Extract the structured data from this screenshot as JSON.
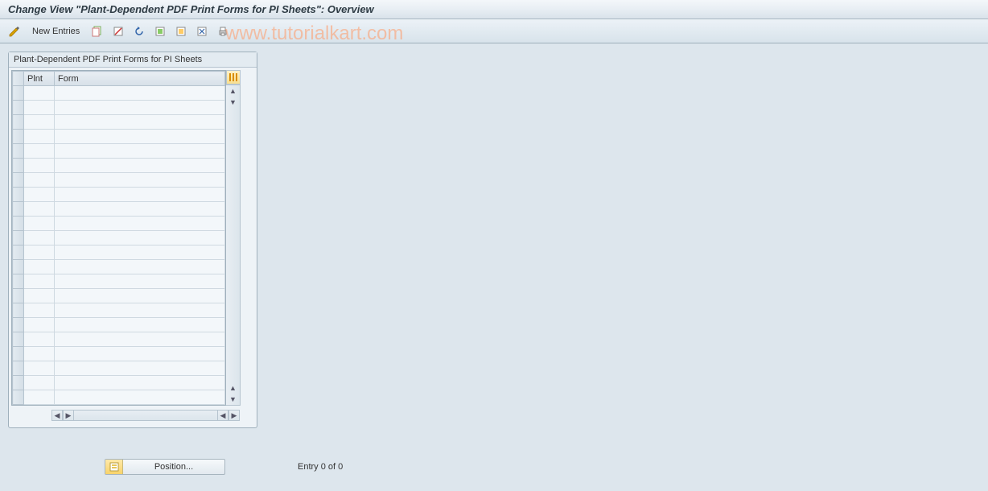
{
  "title": "Change View \"Plant-Dependent PDF Print Forms for PI Sheets\": Overview",
  "toolbar": {
    "new_entries": "New Entries"
  },
  "watermark": "www.tutorialkart.com",
  "panel": {
    "title": "Plant-Dependent PDF Print Forms for PI Sheets",
    "columns": {
      "plnt": "Plnt",
      "form": "Form"
    }
  },
  "footer": {
    "position_label": "Position...",
    "entry_text": "Entry 0 of 0"
  }
}
